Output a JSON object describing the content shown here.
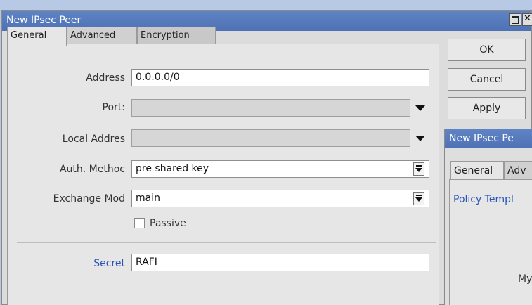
{
  "window": {
    "title": "New IPsec Peer",
    "tabs": [
      "General",
      "Advanced",
      "Encryption"
    ]
  },
  "form": {
    "address": {
      "label": "Address",
      "value": "0.0.0.0/0"
    },
    "port": {
      "label": "Port:",
      "value": ""
    },
    "local_address": {
      "label": "Local Addres",
      "value": ""
    },
    "auth_method": {
      "label": "Auth. Methoc",
      "value": "pre shared key"
    },
    "exchange_mode": {
      "label": "Exchange Mod",
      "value": "main"
    },
    "passive": {
      "label": "Passive",
      "checked": false
    },
    "secret": {
      "label": "Secret",
      "value": "RAFI"
    }
  },
  "buttons": {
    "ok": "OK",
    "cancel": "Cancel",
    "apply": "Apply"
  },
  "second_window": {
    "title": "New IPsec Pe",
    "tabs": [
      "General",
      "Adv"
    ],
    "policy_label": "Policy Templ",
    "my_label": "My"
  },
  "colors": {
    "titlebar": "#5476b9",
    "link_label": "#2a55b8"
  }
}
